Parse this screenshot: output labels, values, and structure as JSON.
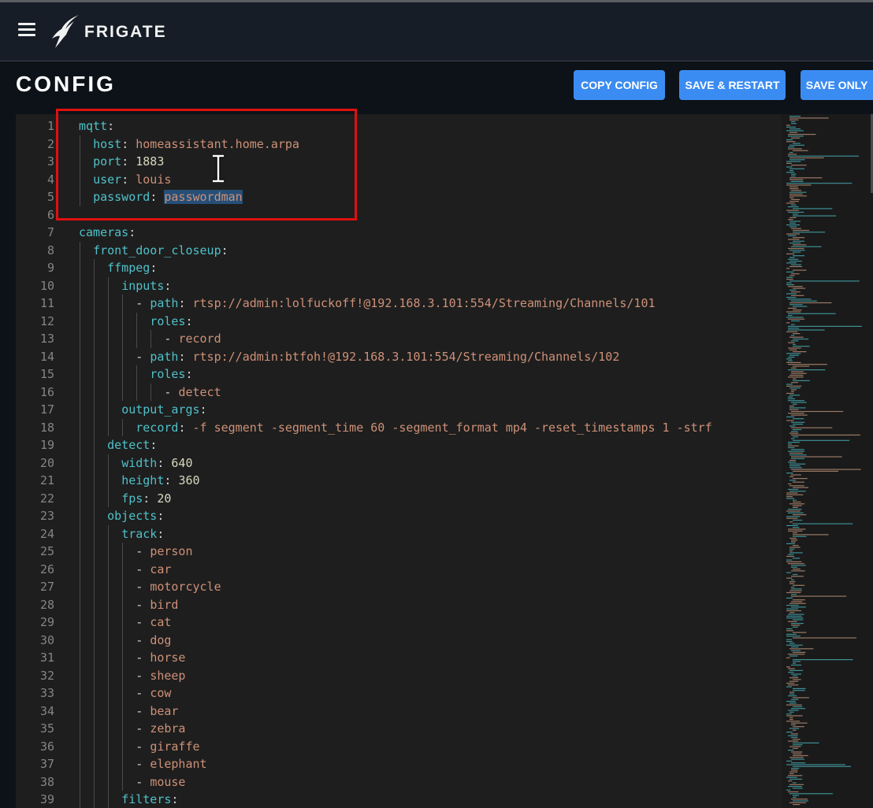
{
  "header": {
    "brand": "FRIGATE",
    "menu_icon": "hamburger-menu-icon",
    "logo_icon": "frigate-bird-logo"
  },
  "page": {
    "title": "CONFIG"
  },
  "toolbar": {
    "copy_label": "COPY CONFIG",
    "save_restart_label": "SAVE & RESTART",
    "save_only_label": "SAVE ONLY"
  },
  "colors": {
    "accent": "#3b8cf2",
    "header_bg": "#161d27",
    "editor_bg": "#1e1e1e",
    "key": "#4fc1c9",
    "string": "#ce9178",
    "highlight_box": "#e01010"
  },
  "editor": {
    "lines": [
      {
        "num": "1",
        "indent": 0,
        "key": "mqtt",
        "value": ""
      },
      {
        "num": "2",
        "indent": 1,
        "key": "host",
        "value": "homeassistant.home.arpa",
        "vtype": "s"
      },
      {
        "num": "3",
        "indent": 1,
        "key": "port",
        "value": "1883",
        "vtype": "n"
      },
      {
        "num": "4",
        "indent": 1,
        "key": "user",
        "value": "louis",
        "vtype": "s"
      },
      {
        "num": "5",
        "indent": 1,
        "key": "password",
        "value": "passwordman",
        "vtype": "s",
        "selected": true
      },
      {
        "num": "6",
        "indent": 0
      },
      {
        "num": "7",
        "indent": 0,
        "key": "cameras",
        "value": ""
      },
      {
        "num": "8",
        "indent": 1,
        "key": "front_door_closeup",
        "value": ""
      },
      {
        "num": "9",
        "indent": 2,
        "key": "ffmpeg",
        "value": ""
      },
      {
        "num": "10",
        "indent": 3,
        "key": "inputs",
        "value": ""
      },
      {
        "num": "11",
        "indent": 4,
        "dash": true,
        "key": "path",
        "value": "rtsp://admin:lolfuckoff!@192.168.3.101:554/Streaming/Channels/101",
        "vtype": "s"
      },
      {
        "num": "12",
        "indent": 5,
        "key": "roles",
        "value": ""
      },
      {
        "num": "13",
        "indent": 6,
        "dash": true,
        "value": "record",
        "vtype": "s"
      },
      {
        "num": "14",
        "indent": 4,
        "dash": true,
        "key": "path",
        "value": "rtsp://admin:btfoh!@192.168.3.101:554/Streaming/Channels/102",
        "vtype": "s"
      },
      {
        "num": "15",
        "indent": 5,
        "key": "roles",
        "value": ""
      },
      {
        "num": "16",
        "indent": 6,
        "dash": true,
        "value": "detect",
        "vtype": "s"
      },
      {
        "num": "17",
        "indent": 3,
        "key": "output_args",
        "value": ""
      },
      {
        "num": "18",
        "indent": 4,
        "key": "record",
        "value": "-f segment -segment_time 60 -segment_format mp4 -reset_timestamps 1 -strf",
        "vtype": "s"
      },
      {
        "num": "19",
        "indent": 2,
        "key": "detect",
        "value": ""
      },
      {
        "num": "20",
        "indent": 3,
        "key": "width",
        "value": "640",
        "vtype": "n"
      },
      {
        "num": "21",
        "indent": 3,
        "key": "height",
        "value": "360",
        "vtype": "n"
      },
      {
        "num": "22",
        "indent": 3,
        "key": "fps",
        "value": "20",
        "vtype": "n"
      },
      {
        "num": "23",
        "indent": 2,
        "key": "objects",
        "value": ""
      },
      {
        "num": "24",
        "indent": 3,
        "key": "track",
        "value": ""
      },
      {
        "num": "25",
        "indent": 4,
        "dash": true,
        "value": "person",
        "vtype": "s"
      },
      {
        "num": "26",
        "indent": 4,
        "dash": true,
        "value": "car",
        "vtype": "s"
      },
      {
        "num": "27",
        "indent": 4,
        "dash": true,
        "value": "motorcycle",
        "vtype": "s"
      },
      {
        "num": "28",
        "indent": 4,
        "dash": true,
        "value": "bird",
        "vtype": "s"
      },
      {
        "num": "29",
        "indent": 4,
        "dash": true,
        "value": "cat",
        "vtype": "s"
      },
      {
        "num": "30",
        "indent": 4,
        "dash": true,
        "value": "dog",
        "vtype": "s"
      },
      {
        "num": "31",
        "indent": 4,
        "dash": true,
        "value": "horse",
        "vtype": "s"
      },
      {
        "num": "32",
        "indent": 4,
        "dash": true,
        "value": "sheep",
        "vtype": "s"
      },
      {
        "num": "33",
        "indent": 4,
        "dash": true,
        "value": "cow",
        "vtype": "s"
      },
      {
        "num": "34",
        "indent": 4,
        "dash": true,
        "value": "bear",
        "vtype": "s"
      },
      {
        "num": "35",
        "indent": 4,
        "dash": true,
        "value": "zebra",
        "vtype": "s"
      },
      {
        "num": "36",
        "indent": 4,
        "dash": true,
        "value": "giraffe",
        "vtype": "s"
      },
      {
        "num": "37",
        "indent": 4,
        "dash": true,
        "value": "elephant",
        "vtype": "s"
      },
      {
        "num": "38",
        "indent": 4,
        "dash": true,
        "value": "mouse",
        "vtype": "s"
      },
      {
        "num": "39",
        "indent": 3,
        "key": "filters",
        "value": ""
      }
    ]
  },
  "overlay": {
    "cursor_icon": "text-cursor-ibeam-icon",
    "highlight": "red-highlight-box"
  }
}
